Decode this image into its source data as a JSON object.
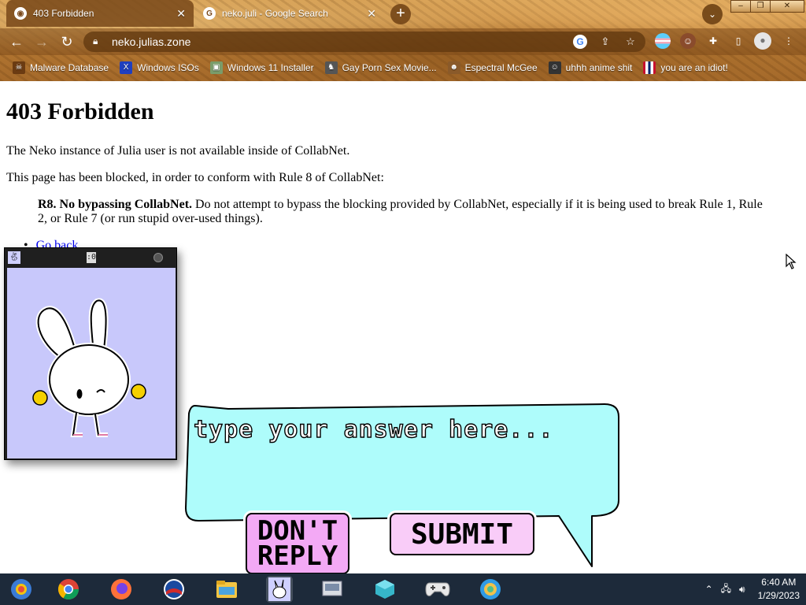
{
  "browser": {
    "tabs": [
      {
        "title": "403 Forbidden",
        "active": true
      },
      {
        "title": "neko.juli - Google Search",
        "active": false
      }
    ],
    "url": "neko.julias.zone",
    "bookmarks": [
      {
        "label": "Malware Database",
        "icon": "skull-icon"
      },
      {
        "label": "Windows ISOs",
        "icon": "x-icon"
      },
      {
        "label": "Windows 11 Installer",
        "icon": "image-icon"
      },
      {
        "label": "Gay Porn Sex Movie...",
        "icon": "figure-icon"
      },
      {
        "label": "Espectral McGee",
        "icon": "avatar-icon"
      },
      {
        "label": "uhhh anime shit",
        "icon": "anime-icon"
      },
      {
        "label": "you are an idiot!",
        "icon": "flag-icon"
      }
    ],
    "accent_color": "#a4692a"
  },
  "page": {
    "heading": "403 Forbidden",
    "para1": "The Neko instance of Julia user is not available inside of CollabNet.",
    "para2": "This page has been blocked, in order to conform with Rule 8 of CollabNet:",
    "rule_title": "R8. No bypassing CollabNet.",
    "rule_text": "Do not attempt to bypass the blocking provided by CollabNet, especially if it is being used to break Rule 1, Rule 2, or Rule 7 (or run stupid over-used things).",
    "go_back": "Go back"
  },
  "neko_window": {
    "title": ":0",
    "background_color": "#c8c8fb"
  },
  "prompt": {
    "placeholder": "type your answer here...",
    "dont_reply_label": "DON'T REPLY",
    "submit_label": "SUBMIT",
    "bubble_color": "#aefcfb"
  },
  "taskbar": {
    "apps": [
      "start-icon",
      "chrome-icon",
      "firefox-icon",
      "obama-icon",
      "file-explorer-icon",
      "neko-icon",
      "scanner-icon",
      "cube-icon",
      "gamepad-icon",
      "edge-icon"
    ],
    "time": "6:40 AM",
    "date": "1/29/2023"
  }
}
